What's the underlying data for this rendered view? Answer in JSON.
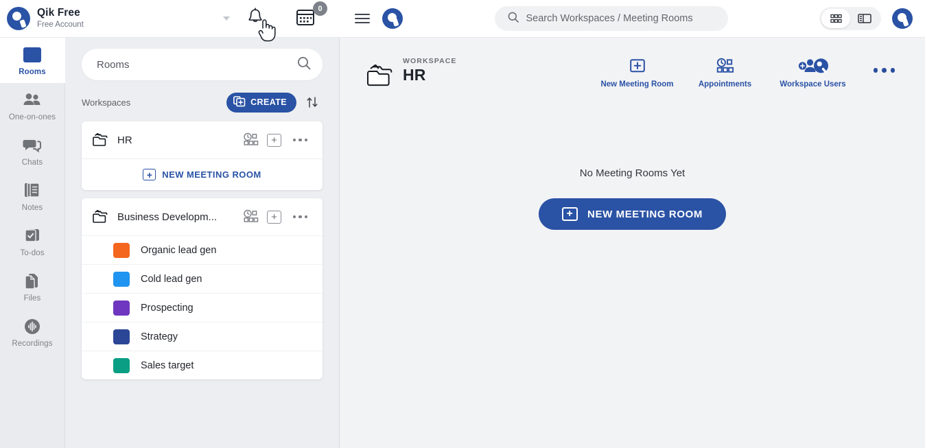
{
  "account": {
    "name": "Qik Free",
    "subtitle": "Free Account",
    "logo_icon": "qik-logo-icon",
    "dropdown_icon": "chevron-down-icon",
    "bell_icon": "bell-icon",
    "calendar_icon": "calendar-icon",
    "calendar_badge": "0",
    "cursor_icon": "pointing-hand-cursor"
  },
  "nav": {
    "items": [
      {
        "label": "Rooms",
        "icon": "rooms-icon",
        "active": true
      },
      {
        "label": "One-on-ones",
        "icon": "people-icon",
        "active": false
      },
      {
        "label": "Chats",
        "icon": "chat-bubble-icon",
        "active": false
      },
      {
        "label": "Notes",
        "icon": "notes-icon",
        "active": false
      },
      {
        "label": "To-dos",
        "icon": "checkbox-icon",
        "active": false
      },
      {
        "label": "Files",
        "icon": "files-icon",
        "active": false
      },
      {
        "label": "Recordings",
        "icon": "recording-icon",
        "active": false
      }
    ]
  },
  "rooms_panel": {
    "search": {
      "value": "",
      "placeholder": "Rooms",
      "icon": "search-icon"
    },
    "section_label": "Workspaces",
    "create_label": "CREATE",
    "create_icon": "create-copy-icon",
    "sort_icon": "sort-arrows-icon",
    "workspaces": [
      {
        "name": "HR",
        "folder_icon": "folder-stack-icon",
        "appointments_icon": "appointments-grid-icon",
        "add_icon": "plus-box-icon",
        "more_icon": "more-horizontal-icon",
        "new_room_label": "NEW MEETING ROOM",
        "new_room_icon": "plus-box-icon",
        "rooms": []
      },
      {
        "name": "Business Developm...",
        "folder_icon": "folder-stack-icon",
        "appointments_icon": "appointments-grid-icon",
        "add_icon": "plus-box-icon",
        "more_icon": "more-horizontal-icon",
        "rooms": [
          {
            "name": "Organic lead gen",
            "color": "#f4661e"
          },
          {
            "name": "Cold lead gen",
            "color": "#1f94f0"
          },
          {
            "name": "Prospecting",
            "color": "#6f36bf"
          },
          {
            "name": "Strategy",
            "color": "#2b4697"
          },
          {
            "name": "Sales target",
            "color": "#0a9e84"
          }
        ]
      }
    ]
  },
  "main_header": {
    "menu_icon": "hamburger-menu-icon",
    "logo_icon": "qik-logo-icon",
    "search": {
      "value": "",
      "placeholder": "Search Workspaces / Meeting Rooms",
      "icon": "search-icon"
    },
    "view_grid_icon": "grid-view-icon",
    "view_panel_icon": "panel-view-icon",
    "avatar_icon": "qik-avatar-icon"
  },
  "workspace": {
    "kicker": "WORKSPACE",
    "title": "HR",
    "folder_icon": "folder-stack-icon",
    "actions": [
      {
        "label": "New Meeting Room",
        "icon": "plus-box-icon"
      },
      {
        "label": "Appointments",
        "icon": "appointments-grid-icon"
      },
      {
        "label": "Workspace Users",
        "icon": "workspace-users-icon"
      }
    ],
    "more_icon": "more-horizontal-icon"
  },
  "empty_state": {
    "message": "No Meeting Rooms Yet",
    "button_label": "NEW MEETING ROOM",
    "button_icon": "plus-box-icon"
  },
  "colors": {
    "brand": "#2a52a5",
    "panel_bg": "#eceef1",
    "rail_bg": "#e9ebef",
    "main_bg": "#f2f3f5"
  }
}
